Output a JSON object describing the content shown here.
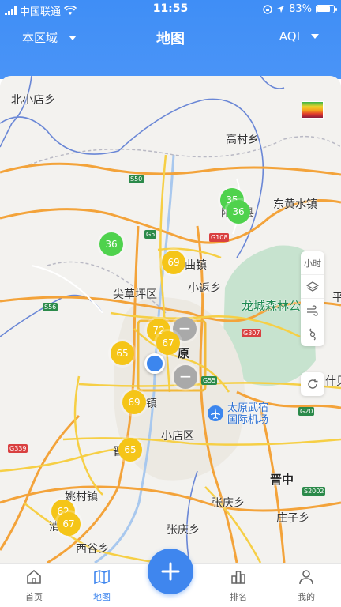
{
  "status_bar": {
    "carrier": "中国联通",
    "time": "11:55",
    "battery": "83%"
  },
  "header": {
    "region_label": "本区域",
    "title": "地图",
    "metric_label": "AQI"
  },
  "map": {
    "places": {
      "beixiaodian": "北小店乡",
      "gaocun": "高村乡",
      "donghuangshui": "东黄水镇",
      "xian_county": "阳曲县",
      "qu_town": "曲镇",
      "xiaofan": "小返乡",
      "jiancaoping": "尖草坪区",
      "longcheng": "龙城森林公园",
      "ping": "平",
      "taiyuan_partial": "原",
      "zhen": "镇",
      "airport": "太原武宿\n国际机场",
      "shen": "什贝",
      "xiaodian": "小店区",
      "jin": "晋",
      "jinzhong": "晋中",
      "yaocun": "姚村镇",
      "qing": "清",
      "zhangqing_1": "张庆乡",
      "zhangqing_2": "张庆乡",
      "xigu": "西谷乡",
      "zhuangzi": "庄子乡"
    },
    "road_badges": {
      "s50": "S50",
      "g5_north": "G5",
      "g108": "G108",
      "s56": "S56",
      "g307": "G307",
      "g55": "G55",
      "g20": "G20",
      "g339": "G339",
      "s2002": "S2002"
    },
    "markers": {
      "m35": "35",
      "m36_north": "36",
      "m36_west": "36",
      "m69_north": "69",
      "m72": "72",
      "m67_center": "67",
      "m65_west": "65",
      "m69_south": "69",
      "m65_south": "65",
      "m62": "62",
      "m67_south": "67",
      "m_gray_1": "−",
      "m_gray_2": "−"
    },
    "tools": {
      "hour_label": "小时"
    },
    "colors": {
      "primary": "#3f86ee",
      "aqi_good": "#4fd24d",
      "aqi_moderate": "#f5c518",
      "no_data": "#a9a9a9"
    }
  },
  "tabbar": {
    "home": "首页",
    "map": "地图",
    "ranking": "排名",
    "mine": "我的"
  }
}
